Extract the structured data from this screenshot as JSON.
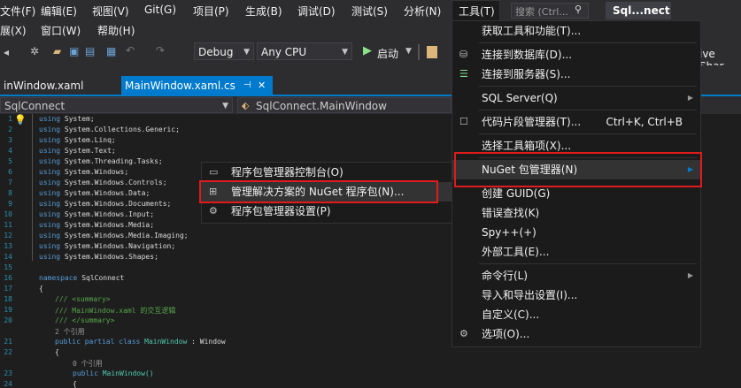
{
  "menubar": {
    "items": [
      "文件(F)",
      "编辑(E)",
      "视图(V)",
      "Git(G)",
      "项目(P)",
      "生成(B)",
      "调试(D)",
      "测试(S)",
      "分析(N)",
      "工具(T)"
    ],
    "search_placeholder": "搜索 (Ctrl...",
    "solution_name": "Sql...nect"
  },
  "menubar2": {
    "items": [
      "展(X)",
      "窗口(W)",
      "帮助(H)"
    ]
  },
  "toolbar": {
    "config": "Debug",
    "platform": "Any CPU",
    "start_label": "启动",
    "live_share": "ive Shar"
  },
  "tabs": [
    {
      "label": "inWindow.xaml"
    },
    {
      "label": "MainWindow.xaml.cs",
      "pin": "⊣",
      "close": "✕"
    }
  ],
  "navbar": {
    "project": "SqlConnect",
    "class": "SqlConnect.MainWindow"
  },
  "code": {
    "usings": [
      "System",
      "System.Collections.Generic",
      "System.Linq",
      "System.Text",
      "System.Threading.Tasks",
      "System.Windows",
      "System.Windows.Controls",
      "System.Windows.Data",
      "System.Windows.Documents",
      "System.Windows.Input",
      "System.Windows.Media",
      "System.Windows.Media.Imaging",
      "System.Windows.Navigation",
      "System.Windows.Shapes"
    ],
    "line_numbers": [
      "1",
      "2",
      "3",
      "4",
      "5",
      "6",
      "7",
      "8",
      "9",
      "10",
      "11",
      "12",
      "13",
      "14",
      "15",
      "16",
      "17",
      "18",
      "19",
      "20",
      "21",
      "22",
      "23",
      "24"
    ],
    "namespace_kw": "namespace",
    "namespace_name": "SqlConnect",
    "brace_open": "{",
    "summary_open": "/// <summary>",
    "summary_text": "/// MainWindow.xaml 的交互逻辑",
    "summary_close": "/// </summary>",
    "refs_2": "2 个引用",
    "class_decl_kw": "public partial class",
    "class_name": "MainWindow",
    "class_base": ": Window",
    "refs_0": "0 个引用",
    "ctor_kw": "public",
    "ctor_name": "MainWindow()"
  },
  "tools_menu": {
    "items": [
      {
        "label": "获取工具和功能(T)..."
      },
      {
        "label": "连接到数据库(D)..."
      },
      {
        "label": "连接到服务器(S)..."
      },
      {
        "label": "SQL Server(Q)",
        "submenu": "▶"
      },
      {
        "label": "代码片段管理器(T)...",
        "shortcut": "Ctrl+K, Ctrl+B"
      },
      {
        "label": "选择工具箱项(X)..."
      },
      {
        "label": "NuGet 包管理器(N)",
        "submenu": "▶"
      },
      {
        "label": "创建 GUID(G)"
      },
      {
        "label": "错误查找(K)"
      },
      {
        "label": "Spy++(+)"
      },
      {
        "label": "外部工具(E)..."
      },
      {
        "label": "命令行(L)",
        "submenu": "▶"
      },
      {
        "label": "导入和导出设置(I)..."
      },
      {
        "label": "自定义(C)..."
      },
      {
        "label": "选项(O)..."
      }
    ]
  },
  "nuget_menu": {
    "items": [
      {
        "label": "程序包管理器控制台(O)"
      },
      {
        "label": "管理解决方案的 NuGet 程序包(N)..."
      },
      {
        "label": "程序包管理器设置(P)"
      }
    ]
  },
  "colors": {
    "accent": "#007acc",
    "highlight_box": "#e01b1b",
    "menu_bg": "#1b1b1c"
  }
}
